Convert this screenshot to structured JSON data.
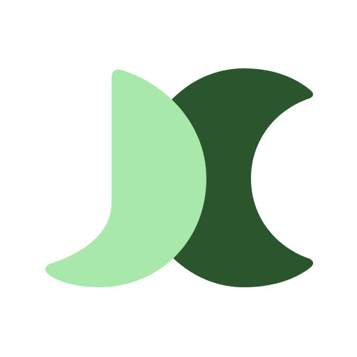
{
  "logo": {
    "icon": "two-crescent-moons-logo-icon",
    "colors": {
      "background": "#ffffff",
      "light_green": "#a8e8ab",
      "dark_green": "#2b552c"
    }
  }
}
